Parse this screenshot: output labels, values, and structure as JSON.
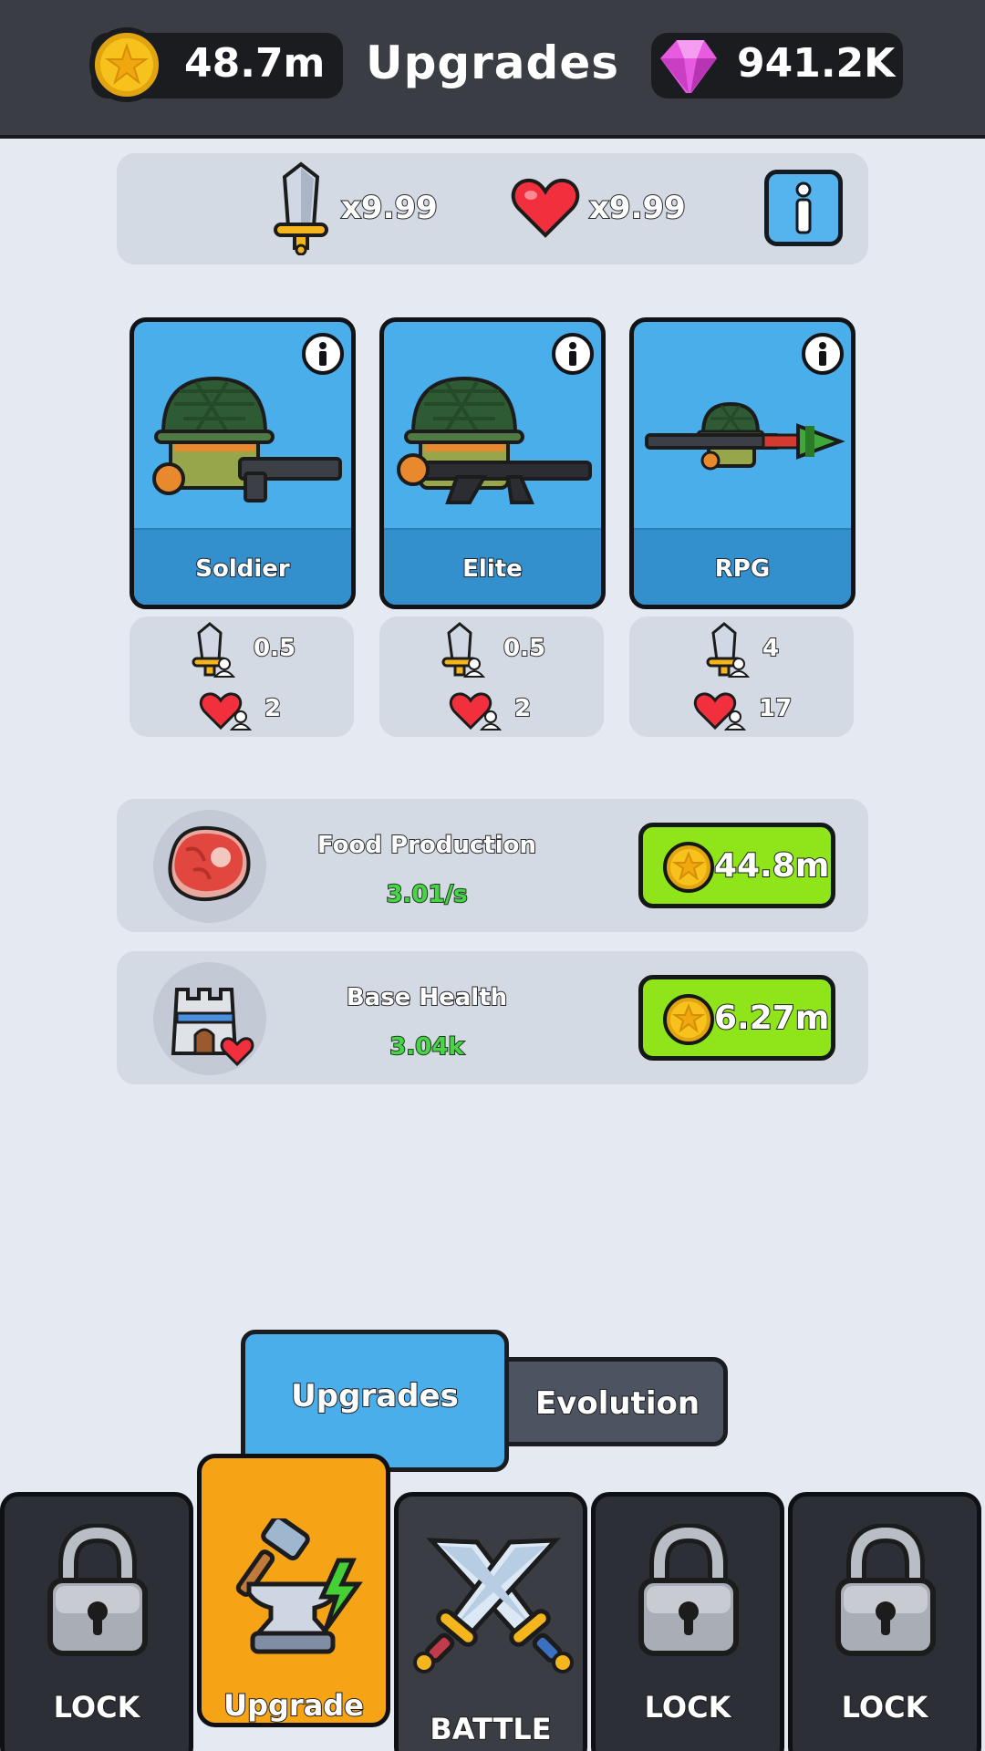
{
  "header": {
    "coins": "48.7m",
    "title": "Upgrades",
    "gems": "941.2K"
  },
  "multipliers": {
    "attack": "x9.99",
    "health": "x9.99"
  },
  "units": [
    {
      "name": "Soldier",
      "attack": "0.5",
      "health": "2"
    },
    {
      "name": "Elite",
      "attack": "0.5",
      "health": "2"
    },
    {
      "name": "RPG",
      "attack": "4",
      "health": "17"
    }
  ],
  "upgrades": [
    {
      "title": "Food Production",
      "value": "3.01/s",
      "cost": "44.8m"
    },
    {
      "title": "Base Health",
      "value": "3.04k",
      "cost": "6.27m"
    }
  ],
  "subtabs": {
    "upgrades": "Upgrades",
    "evolution": "Evolution"
  },
  "nav": [
    {
      "label": "LOCK",
      "icon": "padlock-icon"
    },
    {
      "label": "Upgrade",
      "icon": "anvil-hammer-icon"
    },
    {
      "label": "BATTLE",
      "icon": "crossed-swords-icon"
    },
    {
      "label": "LOCK",
      "icon": "padlock-icon"
    },
    {
      "label": "LOCK",
      "icon": "padlock-icon"
    }
  ],
  "colors": {
    "header_bg": "#3a3d44",
    "accent_blue": "#4aaeea",
    "buy_green": "#8fe51a",
    "active_tab_orange": "#f6a416",
    "value_green": "#47d447",
    "coin_gold": "#f7c21c",
    "gem_pink": "#e65be0"
  }
}
